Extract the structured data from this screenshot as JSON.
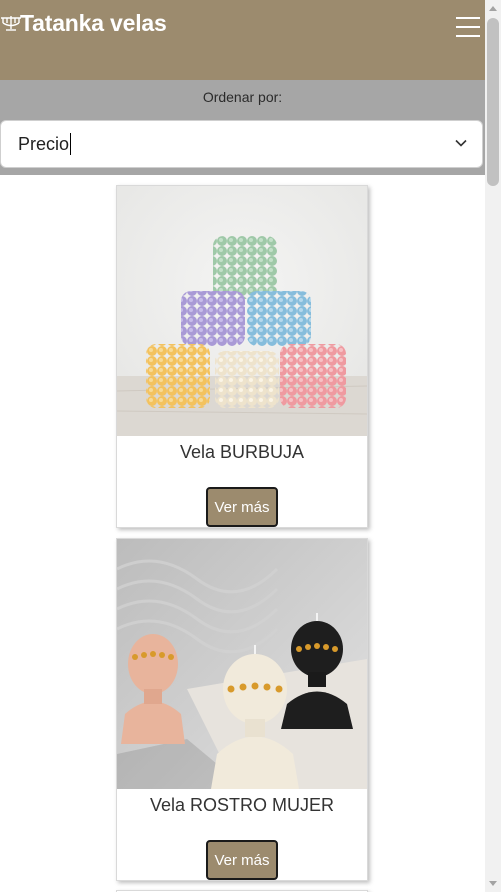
{
  "navbar": {
    "brand": "Tatanka velas",
    "brand_icon": "menorah-icon",
    "menu_icon": "hamburger-menu-icon",
    "background": "#9c8b6e"
  },
  "sort": {
    "label": "Ordenar por:",
    "selected": "Precio",
    "bar_color": "#a6a6a6"
  },
  "products": [
    {
      "name": "Vela BURBUJA",
      "button": "Ver más"
    },
    {
      "name": "Vela ROSTRO MUJER",
      "button": "Ver más"
    }
  ]
}
